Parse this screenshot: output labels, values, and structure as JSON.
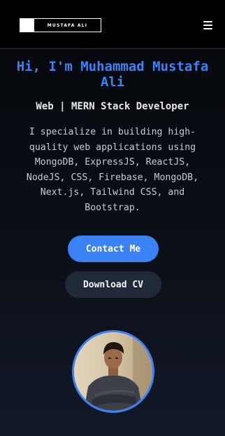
{
  "header": {
    "logo_text": "MUSTAFA ALI",
    "menu_icon": "hamburger-menu-icon"
  },
  "hero": {
    "title": "Hi, I'm Muhammad Mustafa Ali",
    "subtitle": "Web | MERN Stack Developer",
    "description": "I specialize in building high-quality web applications using MongoDB, ExpressJS, ReactJS, NodeJS, CSS, Firebase, MongoDB, Next.js, Tailwind CSS, and Bootstrap.",
    "contact_label": "Contact Me",
    "cv_label": "Download CV"
  },
  "colors": {
    "accent": "#3b82f6",
    "secondary_button": "#1f2937",
    "header_bg": "#000000"
  }
}
